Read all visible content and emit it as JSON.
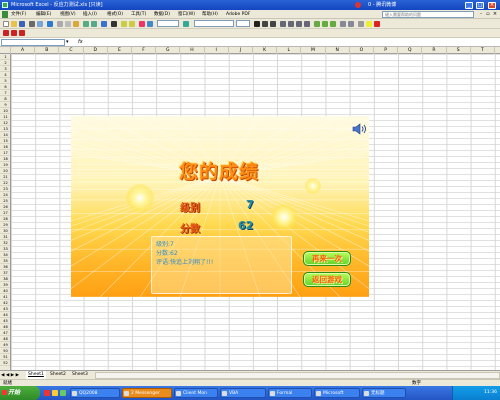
{
  "window": {
    "title": "Microsoft Excel - 反应力测试.xls [只读]",
    "middle_text": "",
    "right_text": "0 - 腾讯微博"
  },
  "menu": {
    "items": [
      "文件(F)",
      "编辑(E)",
      "视图(V)",
      "插入(I)",
      "格式(O)",
      "工具(T)",
      "数据(D)",
      "窗口(W)",
      "帮助(H)",
      "Adobe PDF"
    ],
    "help_placeholder": "键入需要帮助的问题"
  },
  "formula_bar": {
    "fx": "fx"
  },
  "columns": [
    "A",
    "B",
    "C",
    "D",
    "E",
    "F",
    "G",
    "H",
    "I",
    "J",
    "K",
    "L",
    "M",
    "N",
    "O",
    "P",
    "Q",
    "R",
    "S",
    "T"
  ],
  "rows": [
    "1",
    "2",
    "3",
    "4",
    "5",
    "6",
    "7",
    "8",
    "9",
    "10",
    "11",
    "12",
    "13",
    "14",
    "15",
    "16",
    "17",
    "18",
    "19",
    "20",
    "21",
    "22",
    "23",
    "24",
    "25",
    "26",
    "27",
    "28",
    "29",
    "30",
    "31",
    "32",
    "33",
    "34",
    "35",
    "36",
    "37",
    "38",
    "39",
    "40",
    "41",
    "42",
    "43",
    "44",
    "45",
    "46",
    "47",
    "48",
    "49",
    "50",
    "51",
    "52"
  ],
  "game": {
    "title": "您的成绩",
    "level_label": "级别",
    "level_value": "7",
    "score_label": "分数",
    "score_value": "62",
    "info_level": "级别:7",
    "info_score": "分数:62",
    "info_comment": "评语:快追上刘翔了!!!",
    "retry_button": "再来一次",
    "back_button": "返回游戏",
    "speaker_icon": "speaker-icon"
  },
  "sheets": {
    "nav": "◀ ◀ ▶ ▶",
    "tabs": [
      "Sheet1",
      "Sheet2",
      "Sheet3"
    ],
    "active": "Sheet1"
  },
  "status": {
    "left": "就绪",
    "right": "数字"
  },
  "taskbar": {
    "start": "开始",
    "buttons": [
      "QQ2008",
      "2 Messenger",
      "Client Mon",
      "VBA",
      "Formal",
      "Microsoft",
      "无标题"
    ],
    "clock": "11:36"
  }
}
